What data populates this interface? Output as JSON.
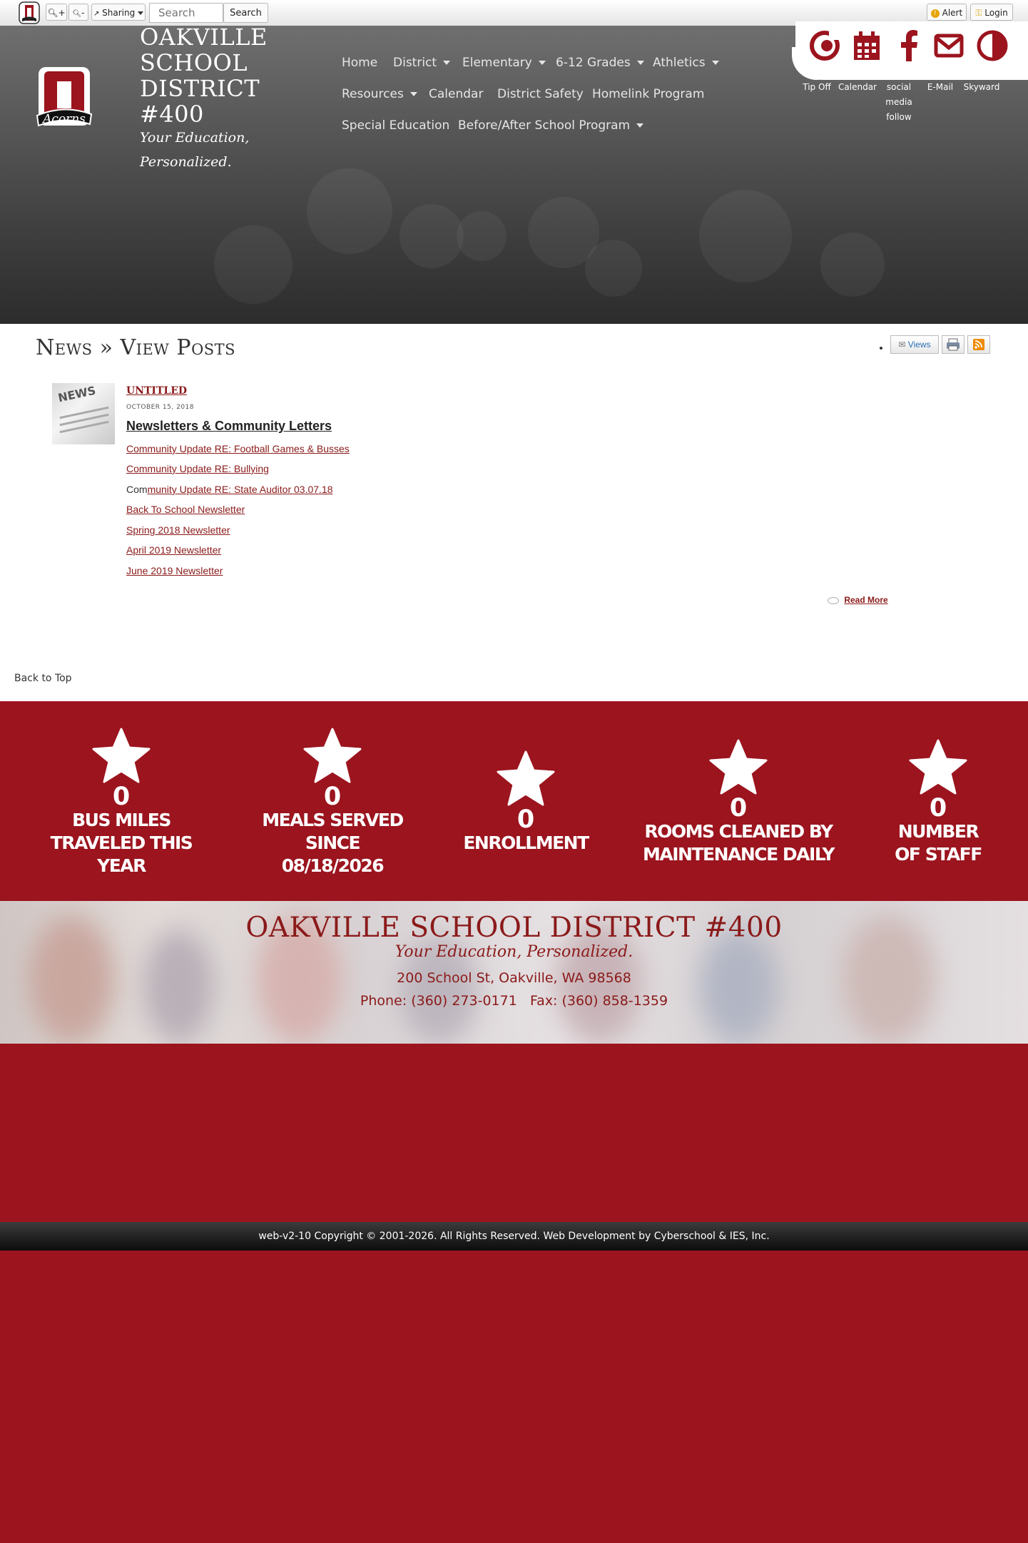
{
  "toolbar": {
    "zoom_in_label": "+",
    "zoom_out_label": "-",
    "sharing_label": "Sharing",
    "search_placeholder": "Search",
    "search_button": "Search",
    "alert_label": "Alert",
    "login_label": "Login"
  },
  "brand": {
    "title_line1": "OAKVILLE",
    "title_line2": "SCHOOL",
    "title_line3": "DISTRICT",
    "title_line4": "#400",
    "tagline_line1": "Your Education,",
    "tagline_line2": "Personalized."
  },
  "nav": {
    "home": "Home",
    "district": "District",
    "elementary": "Elementary",
    "grades": "6-12 Grades",
    "athletics": "Athletics",
    "resources": "Resources",
    "calendar": "Calendar",
    "safety": "District Safety",
    "homelink": "Homelink Program",
    "special_ed": "Special Education",
    "before_after": "Before/After School Program"
  },
  "quick_links": {
    "tipoff": "Tip Off",
    "calendar": "Calendar",
    "social_line1": "social",
    "social_line2": "media",
    "social_line3": "follow",
    "email": "E-Mail",
    "skyward": "Skyward"
  },
  "page": {
    "title": "News » View Posts",
    "views_label": "Views",
    "back_to_top": "Back to Top"
  },
  "post": {
    "thumb_label": "NEWS",
    "category": "UNTITLED",
    "date": "OCTOBER 15, 2018",
    "heading": "Newsletters & Community Letters",
    "links": [
      "Community Update RE: Football Games & Busses",
      "Community Update RE: Bullying",
      "Community Update RE: State Auditor 03.07.18",
      "Back To School Newsletter",
      "Spring 2018 Newsletter",
      "April 2019 Newsletter",
      "June 2019 Newsletter"
    ],
    "link3_plain": "Com",
    "link3_linked": "munity Update RE: State Auditor 03.07.18",
    "read_more": "Read More"
  },
  "stats": [
    {
      "value": "0",
      "label_line1": "BUS MILES",
      "label_line2": "TRAVELED THIS",
      "label_line3": "YEAR"
    },
    {
      "value": "0",
      "label_line1": "MEALS SERVED",
      "label_line2": "SINCE",
      "label_line3": "08/18/2026"
    },
    {
      "value": "0",
      "label_line1": "ENROLLMENT"
    },
    {
      "value": "0",
      "label_line1": "ROOMS CLEANED BY",
      "label_line2": "MAINTENANCE DAILY"
    },
    {
      "value": "0",
      "label_line1": "NUMBER",
      "label_line2": "OF STAFF"
    }
  ],
  "footer": {
    "title": "OAKVILLE SCHOOL DISTRICT #400",
    "tagline": "Your Education, Personalized.",
    "address": "200 School St, Oakville, WA 98568",
    "phone": "Phone: (360) 273-0171",
    "fax": "Fax: (360) 858-1359",
    "copyright": "web-v2-10 Copyright © 2001-2026. All Rights Reserved. Web Development by Cyberschool & IES, Inc."
  },
  "colors": {
    "brand_red": "#9b141e",
    "link_red": "#8b1a1a",
    "header_gray": "#4a4a4a"
  }
}
